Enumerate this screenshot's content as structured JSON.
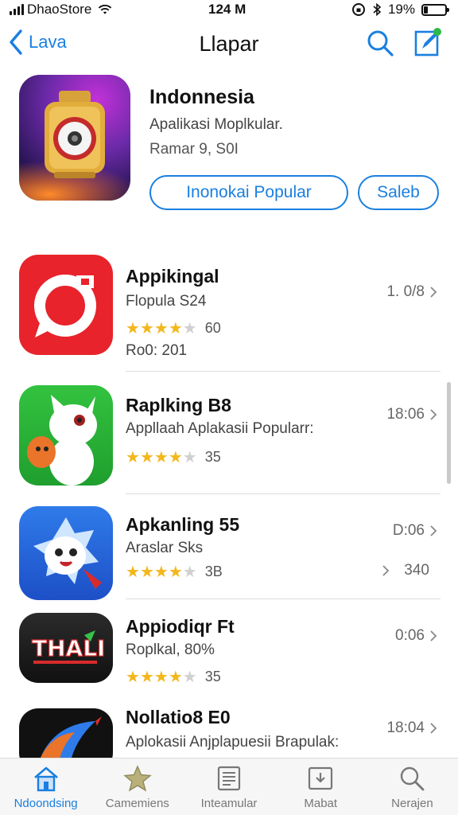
{
  "status_bar": {
    "carrier": "DhaoStore",
    "time": "124 M",
    "battery": "19%",
    "battery_level": 0.19
  },
  "nav": {
    "back_label": "Lava",
    "title": "Llapar"
  },
  "featured": {
    "title": "Indonnesia",
    "subtitle": "Apalikasi Moplkular.",
    "meta": "Ramar 9, S0I",
    "primary_button": "Inonokai Popular",
    "secondary_button": "Saleb"
  },
  "apps": [
    {
      "name": "Appikingal",
      "subtitle": "Flopula S24",
      "rating": 4,
      "rating_count": "60",
      "extra": "Ro0: 201",
      "right_text": "1. 0/8",
      "icon": "red-chat-icon"
    },
    {
      "name": "Raplking B8",
      "subtitle": "Appllaah Aplakasii Popularr:",
      "rating": 4,
      "rating_count": "35",
      "extra": "",
      "right_text": "18:06",
      "icon": "green-cat-icon"
    },
    {
      "name": "Apkanling 55",
      "subtitle": "Araslar Sks",
      "rating": 4,
      "rating_count": "3B",
      "extra": "",
      "right_text": "D:06",
      "right_text_2": "340",
      "icon": "blue-mascot-icon"
    },
    {
      "name": "Appiodiqr Ft",
      "subtitle": "Roplkal, 80%",
      "rating": 4,
      "rating_count": "35",
      "extra": "",
      "right_text": "0:06",
      "icon": "thali-game-icon"
    },
    {
      "name": "Nollatio8 E0",
      "subtitle": "Aplokasii Anjplapuesii Brapulak:",
      "rating": 0,
      "rating_count": "",
      "extra": "",
      "right_text": "18:04",
      "icon": "bird-logo-icon"
    }
  ],
  "tabs": [
    {
      "label": "Ndoondsing",
      "icon": "home-icon",
      "active": true
    },
    {
      "label": "Camemiens",
      "icon": "star-icon",
      "active": false
    },
    {
      "label": "Inteamular",
      "icon": "news-icon",
      "active": false
    },
    {
      "label": "Mabat",
      "icon": "updates-icon",
      "active": false
    },
    {
      "label": "Nerajen",
      "icon": "search-icon",
      "active": false
    }
  ],
  "colors": {
    "accent": "#1a7fe0",
    "star": "#f3b71b"
  },
  "icon_text": {
    "thali_logo": "THALI"
  }
}
